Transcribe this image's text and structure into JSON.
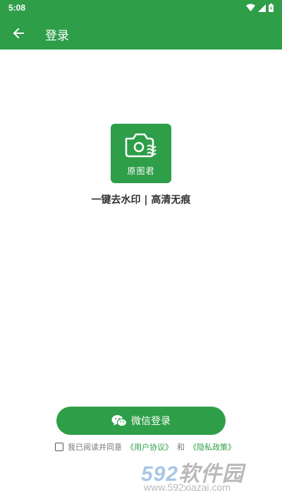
{
  "status_bar": {
    "time": "5:08",
    "icons": [
      "wifi-icon",
      "signal-icon",
      "battery-icon"
    ]
  },
  "app_bar": {
    "title": "登录",
    "back_icon": "arrow-left-icon"
  },
  "logo": {
    "brand_name": "原图君",
    "icon": "camera-icon"
  },
  "slogan": "一键去水印 | 高清无痕",
  "login_button": {
    "label": "微信登录",
    "icon": "wechat-icon"
  },
  "agreement": {
    "checked": false,
    "prefix": "我已阅读并同意",
    "user_agreement": "《用户协议》",
    "conjunction": "和",
    "privacy_policy": "《隐私政策》"
  },
  "watermark": {
    "text_num": "592",
    "text_cn": "软件园",
    "url": "www.592xiazai.com"
  },
  "colors": {
    "primary": "#2e9e48",
    "text": "#333333",
    "muted": "#777777"
  }
}
